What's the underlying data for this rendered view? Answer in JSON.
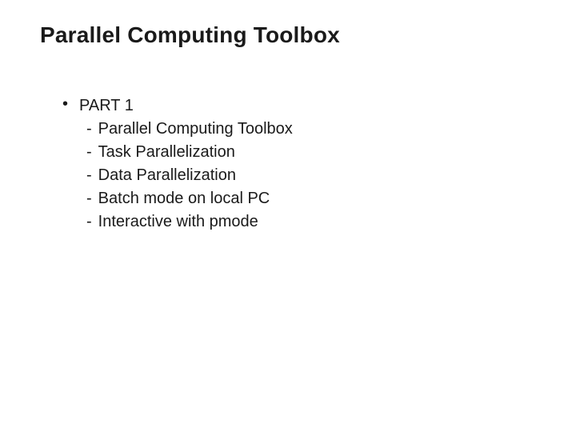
{
  "slide": {
    "title": "Parallel Computing Toolbox",
    "part_label": "PART 1",
    "bullet_glyph": "•",
    "dash_glyph": "-",
    "items": [
      "Parallel Computing Toolbox",
      "Task Parallelization",
      "Data Parallelization",
      "Batch mode on local PC",
      "Interactive with pmode"
    ]
  }
}
